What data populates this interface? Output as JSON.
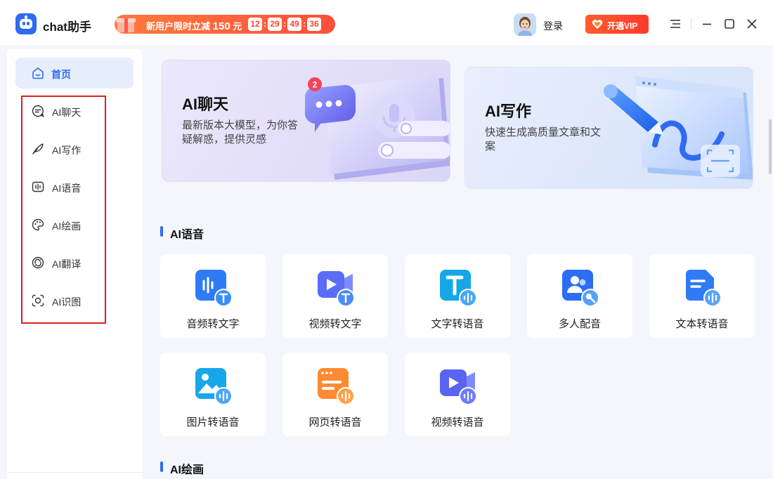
{
  "app": {
    "title": "chat助手"
  },
  "promo": {
    "text": "新用户限时立减",
    "amount": "150",
    "unit": "元",
    "countdown": [
      "12",
      "29",
      "49",
      "36"
    ]
  },
  "header": {
    "login_label": "登录",
    "vip_label": "开通VIP"
  },
  "sidebar": {
    "home_label": "首页",
    "items": [
      {
        "label": "AI聊天",
        "icon": "chat-bubble-icon"
      },
      {
        "label": "AI写作",
        "icon": "feather-icon"
      },
      {
        "label": "AI语音",
        "icon": "voice-wave-icon"
      },
      {
        "label": "AI绘画",
        "icon": "palette-icon"
      },
      {
        "label": "AI翻译",
        "icon": "translate-icon"
      },
      {
        "label": "AI识图",
        "icon": "scan-image-icon"
      }
    ]
  },
  "hero": {
    "chat": {
      "title": "AI聊天",
      "desc": "最新版本大模型，为你答疑解惑，提供灵感",
      "badge": "2"
    },
    "write": {
      "title": "AI写作",
      "desc": "快速生成高质量文章和文案"
    }
  },
  "sections": {
    "voice_title": "AI语音",
    "paint_title": "AI绘画"
  },
  "voice_tools": [
    {
      "label": "音频转文字",
      "icon": "audio-to-text-icon"
    },
    {
      "label": "视频转文字",
      "icon": "video-to-text-icon"
    },
    {
      "label": "文字转语音",
      "icon": "text-to-speech-icon"
    },
    {
      "label": "多人配音",
      "icon": "multi-dubbing-icon"
    },
    {
      "label": "文本转语音",
      "icon": "document-to-speech-icon"
    },
    {
      "label": "图片转语音",
      "icon": "image-to-speech-icon"
    },
    {
      "label": "网页转语音",
      "icon": "webpage-to-speech-icon"
    },
    {
      "label": "视频转语音",
      "icon": "video-to-speech-icon"
    }
  ],
  "colors": {
    "accent": "#2f6bf0",
    "promo": "#ff4f3c",
    "highlight_frame": "#e01e1e"
  }
}
